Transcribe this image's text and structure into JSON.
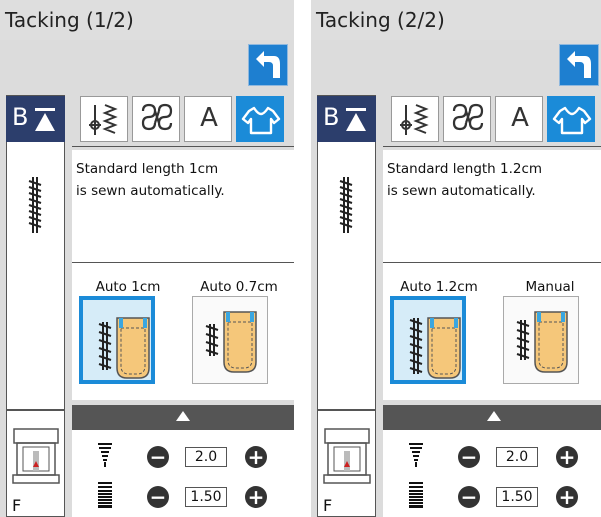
{
  "panels": [
    {
      "title": "Tacking (1/2)",
      "tabs": [
        "length-stitch-icon",
        "decorative-stitch-icon",
        "A",
        "shirt-icon"
      ],
      "description": "Standard length 1cm\nis sewn automatically.",
      "options": [
        {
          "label": "Auto 1cm",
          "selected": true
        },
        {
          "label": "Auto 0.7cm",
          "selected": false
        }
      ],
      "width_value": "2.0",
      "length_value": "1.50",
      "foot": "F"
    },
    {
      "title": "Tacking (2/2)",
      "tabs": [
        "length-stitch-icon",
        "decorative-stitch-icon",
        "A",
        "shirt-icon"
      ],
      "description": "Standard length 1.2cm\nis sewn automatically.",
      "options": [
        {
          "label": "Auto 1.2cm",
          "selected": true
        },
        {
          "label": "Manual",
          "selected": false
        }
      ],
      "width_value": "2.0",
      "length_value": "1.50",
      "foot": "F"
    }
  ],
  "common": {
    "bt_label": "B",
    "minus": "−",
    "plus": "+"
  },
  "colors": {
    "accent": "#1b8bd8",
    "title_bg": "#dedede",
    "body_bg": "#dcdcdc",
    "bt_bg": "#2c3e6c",
    "dark_bar": "#555555"
  }
}
